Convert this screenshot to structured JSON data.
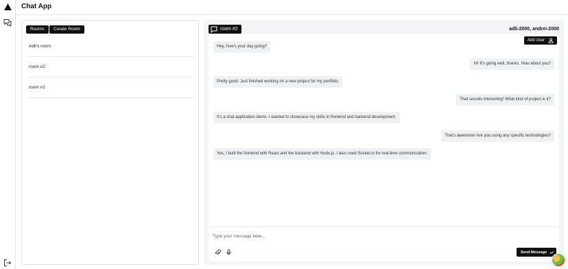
{
  "app": {
    "title": "Chat App"
  },
  "rail": {
    "logo_icon": "triangle-logo-icon",
    "chats_icon": "chats-icon",
    "logout_icon": "logout-icon"
  },
  "rooms_panel": {
    "tabs": [
      {
        "label": "Rooms"
      },
      {
        "label": "Create Room"
      }
    ],
    "rooms": [
      {
        "name": "Adli's room"
      },
      {
        "name": "room #2"
      },
      {
        "name": "room #1"
      }
    ]
  },
  "chat": {
    "room_name": "room #2",
    "participants": "adli-2000, andrei-2000",
    "add_user_label": "Add User",
    "messages": [
      {
        "side": "left",
        "text": "Hey, how's your day going?"
      },
      {
        "side": "right",
        "text": "Hi! It's going well, thanks. How about you?"
      },
      {
        "side": "left",
        "text": "Pretty good. Just finished working on a new project for my portfolio."
      },
      {
        "side": "right",
        "text": "That sounds interesting! What kind of project is it?"
      },
      {
        "side": "left",
        "text": "It's a chat application demo. I wanted to showcase my skills in frontend and backend development."
      },
      {
        "side": "right",
        "text": "That's awesome! Are you using any specific technologies?"
      },
      {
        "side": "left",
        "text": "Yes, I built the frontend with React and the backend with Node.js. I also used Socket.io for real-time communication."
      }
    ],
    "composer": {
      "placeholder": "Type your message here...",
      "value": "",
      "send_label": "Send Message"
    }
  },
  "colors": {
    "primary": "#111111",
    "bubble": "#eff0f2",
    "panel_bg": "#f3f4f6"
  }
}
